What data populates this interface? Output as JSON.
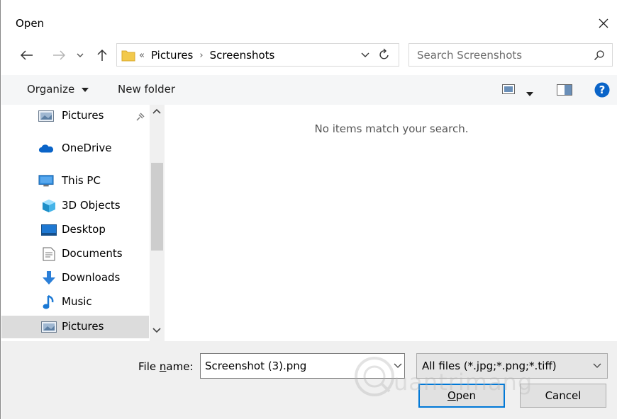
{
  "window": {
    "title": "Open"
  },
  "address": {
    "overflow": "«",
    "crumbs": [
      "Pictures",
      "Screenshots"
    ]
  },
  "search": {
    "placeholder": "Search Screenshots"
  },
  "toolbar": {
    "organize": "Organize",
    "new_folder": "New folder"
  },
  "nav": {
    "items": [
      {
        "label": "Pictures",
        "icon": "pictures-icon"
      },
      {
        "label": "OneDrive",
        "icon": "onedrive-icon"
      },
      {
        "label": "This PC",
        "icon": "this-pc-icon"
      },
      {
        "label": "3D Objects",
        "icon": "3d-objects-icon"
      },
      {
        "label": "Desktop",
        "icon": "desktop-icon"
      },
      {
        "label": "Documents",
        "icon": "documents-icon"
      },
      {
        "label": "Downloads",
        "icon": "downloads-icon"
      },
      {
        "label": "Music",
        "icon": "music-icon"
      },
      {
        "label": "Pictures",
        "icon": "pictures-icon"
      }
    ]
  },
  "content": {
    "empty_message": "No items match your search."
  },
  "bottom": {
    "file_name_label_pre": "File ",
    "file_name_label_u": "n",
    "file_name_label_post": "ame:",
    "file_name_value": "Screenshot (3).png",
    "filter_value": "All files (*.jpg;*.png;*.tiff)",
    "open_u": "O",
    "open_rest": "pen",
    "cancel": "Cancel"
  },
  "watermark": {
    "text": "uantrimang"
  },
  "colors": {
    "accent": "#0078d7",
    "help": "#0a64c8",
    "selected": "#dcdcdc"
  }
}
